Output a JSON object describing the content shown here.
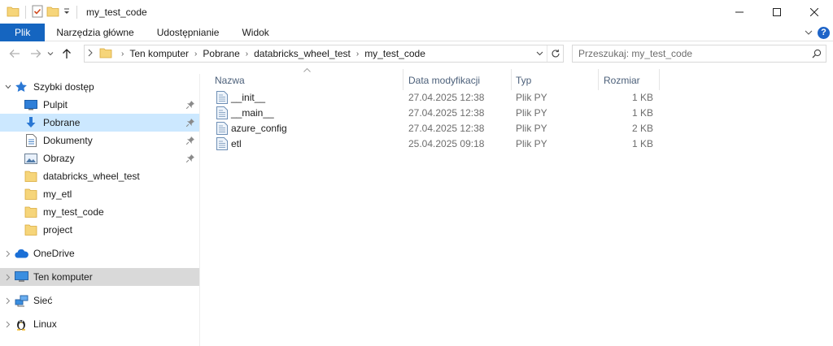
{
  "window": {
    "title": "my_test_code",
    "quick_access_icons": [
      "folder-icon",
      "properties-checkmark-icon",
      "new-folder-icon",
      "customize-dropdown-icon"
    ]
  },
  "ribbon": {
    "tabs": [
      "Plik",
      "Narzędzia główne",
      "Udostępnianie",
      "Widok"
    ],
    "help": "?"
  },
  "address": {
    "breadcrumb": [
      "Ten komputer",
      "Pobrane",
      "databricks_wheel_test",
      "my_test_code"
    ]
  },
  "search": {
    "placeholder": "Przeszukaj: my_test_code"
  },
  "sidebar": {
    "quick_access": "Szybki dostęp",
    "items": [
      {
        "label": "Pulpit",
        "icon": "desktop-icon",
        "pinned": true
      },
      {
        "label": "Pobrane",
        "icon": "download-arrow-icon",
        "pinned": true
      },
      {
        "label": "Dokumenty",
        "icon": "documents-icon",
        "pinned": true
      },
      {
        "label": "Obrazy",
        "icon": "pictures-icon",
        "pinned": true
      },
      {
        "label": "databricks_wheel_test",
        "icon": "folder-icon",
        "pinned": false
      },
      {
        "label": "my_etl",
        "icon": "folder-icon",
        "pinned": false
      },
      {
        "label": "my_test_code",
        "icon": "folder-icon",
        "pinned": false
      },
      {
        "label": "project",
        "icon": "folder-icon",
        "pinned": false
      }
    ],
    "onedrive": "OneDrive",
    "this_pc": "Ten komputer",
    "network": "Sieć",
    "linux": "Linux"
  },
  "files": {
    "columns": [
      "Nazwa",
      "Data modyfikacji",
      "Typ",
      "Rozmiar"
    ],
    "rows": [
      {
        "name": "__init__",
        "modified": "27.04.2025 12:38",
        "type": "Plik PY",
        "size": "1 KB"
      },
      {
        "name": "__main__",
        "modified": "27.04.2025 12:38",
        "type": "Plik PY",
        "size": "1 KB"
      },
      {
        "name": "azure_config",
        "modified": "27.04.2025 12:38",
        "type": "Plik PY",
        "size": "2 KB"
      },
      {
        "name": "etl",
        "modified": "25.04.2025 09:18",
        "type": "Plik PY",
        "size": "1 KB"
      }
    ]
  },
  "colors": {
    "file_tab": "#1565c0",
    "selected_nav": "#cce8ff",
    "hover_nav": "#d9d9d9",
    "folder": "#f6d57a",
    "header_text": "#4c607a"
  }
}
